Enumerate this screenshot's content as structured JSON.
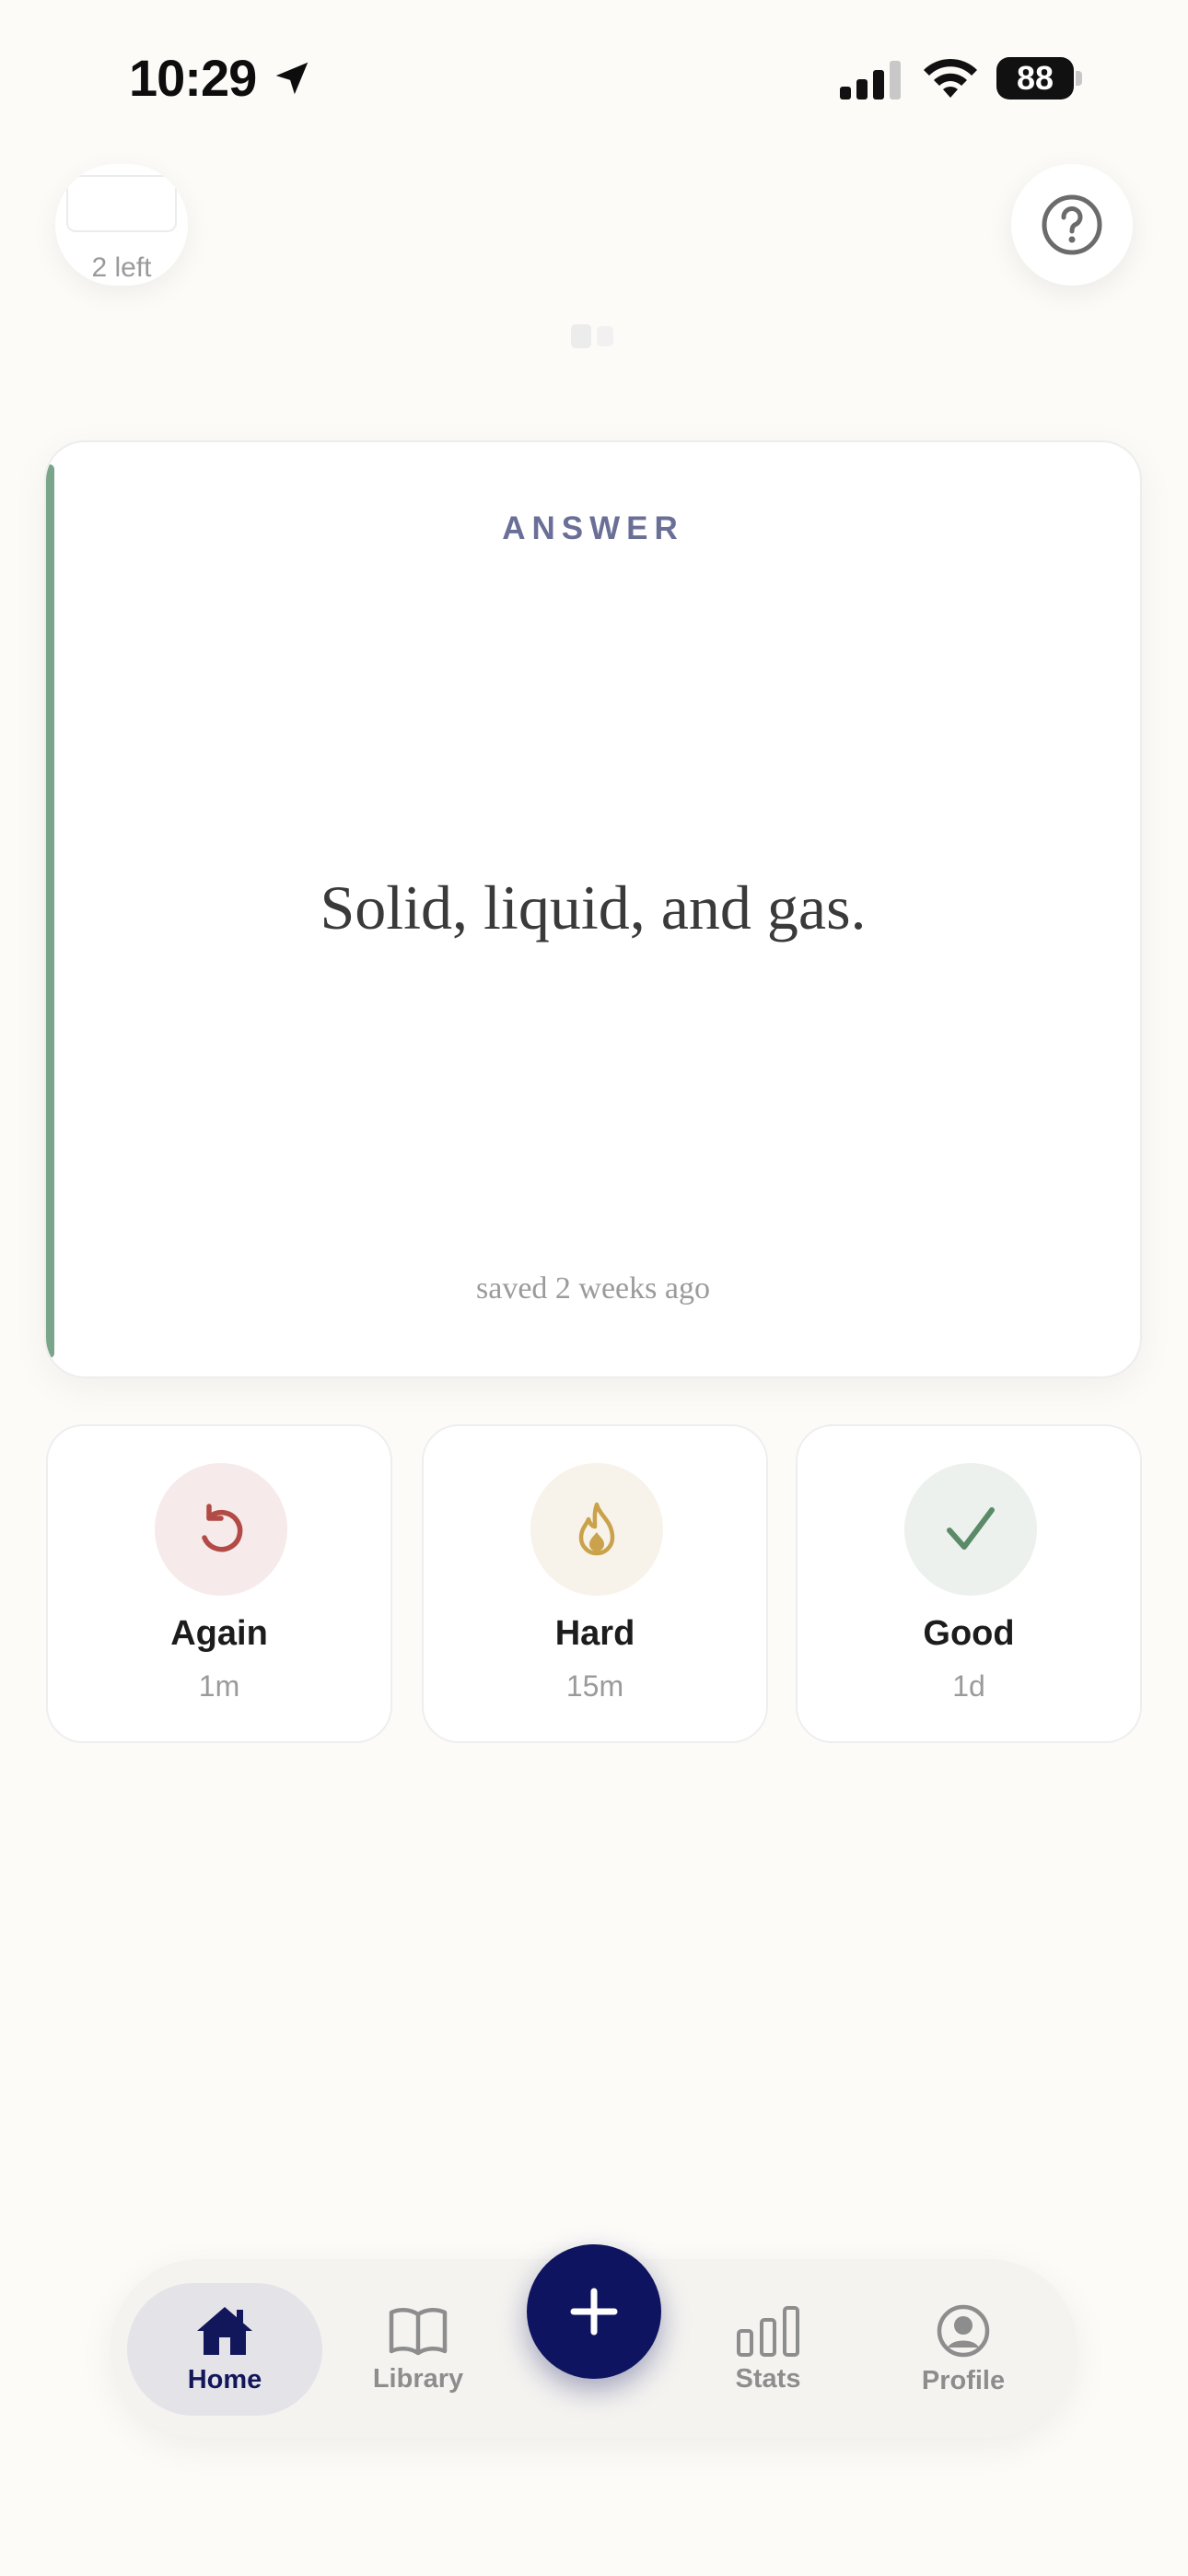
{
  "status_bar": {
    "time": "10:29",
    "battery": "88",
    "icons": [
      "location-arrow-icon",
      "cellular-signal-icon",
      "wifi-icon",
      "battery-icon"
    ]
  },
  "header": {
    "cards_left": "2 left",
    "help_icon": "question-circle-icon"
  },
  "card": {
    "label": "ANSWER",
    "text": "Solid, liquid, and gas.",
    "meta": "saved 2 weeks ago",
    "accent_color": "#7aa58a"
  },
  "ratings": [
    {
      "label": "Again",
      "interval": "1m",
      "icon": "undo-arrow-icon",
      "color": "#b24a45",
      "bg": "#f7eaea"
    },
    {
      "label": "Hard",
      "interval": "15m",
      "icon": "flame-icon",
      "color": "#c9a24b",
      "bg": "#f7f3ea"
    },
    {
      "label": "Good",
      "interval": "1d",
      "icon": "checkmark-icon",
      "color": "#5b8a69",
      "bg": "#ecf1ed"
    }
  ],
  "nav": {
    "home": "Home",
    "library": "Library",
    "stats": "Stats",
    "profile": "Profile",
    "add_icon": "plus-icon",
    "active": "Home",
    "active_color": "#12175b"
  }
}
